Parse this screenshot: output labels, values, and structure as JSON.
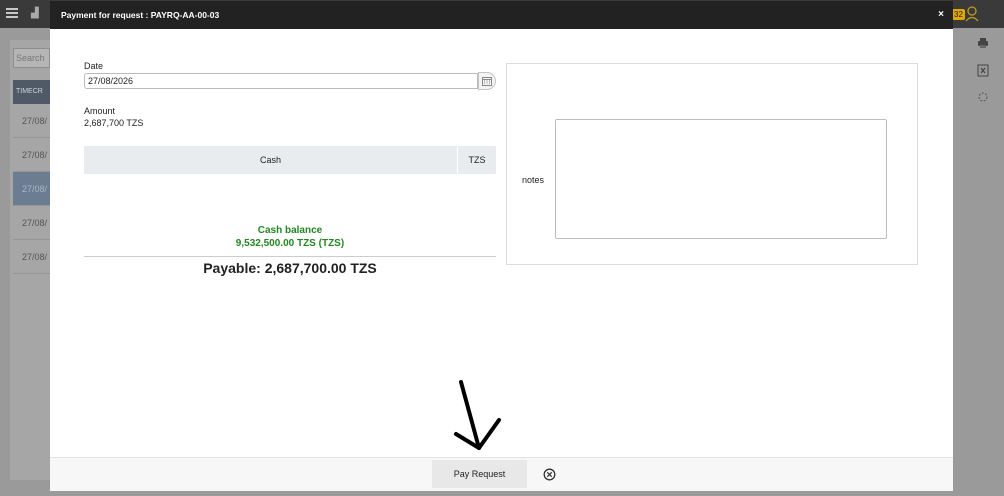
{
  "background": {
    "search_placeholder": "Search",
    "table_header": "TIMECR",
    "rows": [
      "27/08/",
      "27/08/",
      "27/08/",
      "27/08/",
      "27/08/"
    ],
    "badge": "32"
  },
  "modal": {
    "title": "Payment for request : PAYRQ-AA-00-03",
    "close_label": "×",
    "date": {
      "label": "Date",
      "value": "27/08/2026"
    },
    "amount": {
      "label": "Amount",
      "value": "2,687,700 TZS"
    },
    "payment_table": {
      "method": "Cash",
      "currency": "TZS"
    },
    "cash_balance": {
      "label": "Cash balance",
      "value": "9,532,500.00 TZS (TZS)"
    },
    "payable": "Payable: 2,687,700.00 TZS",
    "notes": {
      "label": "notes",
      "value": ""
    },
    "footer": {
      "pay_label": "Pay Request"
    }
  },
  "colors": {
    "header_bg": "#222222",
    "balance_green": "#1e8a1e",
    "table_bg": "#e9ecef"
  },
  "icons": [
    "calendar-icon",
    "cancel-circle-icon",
    "print-icon",
    "excel-icon",
    "settings-icon",
    "menu-icon",
    "user-icon"
  ]
}
